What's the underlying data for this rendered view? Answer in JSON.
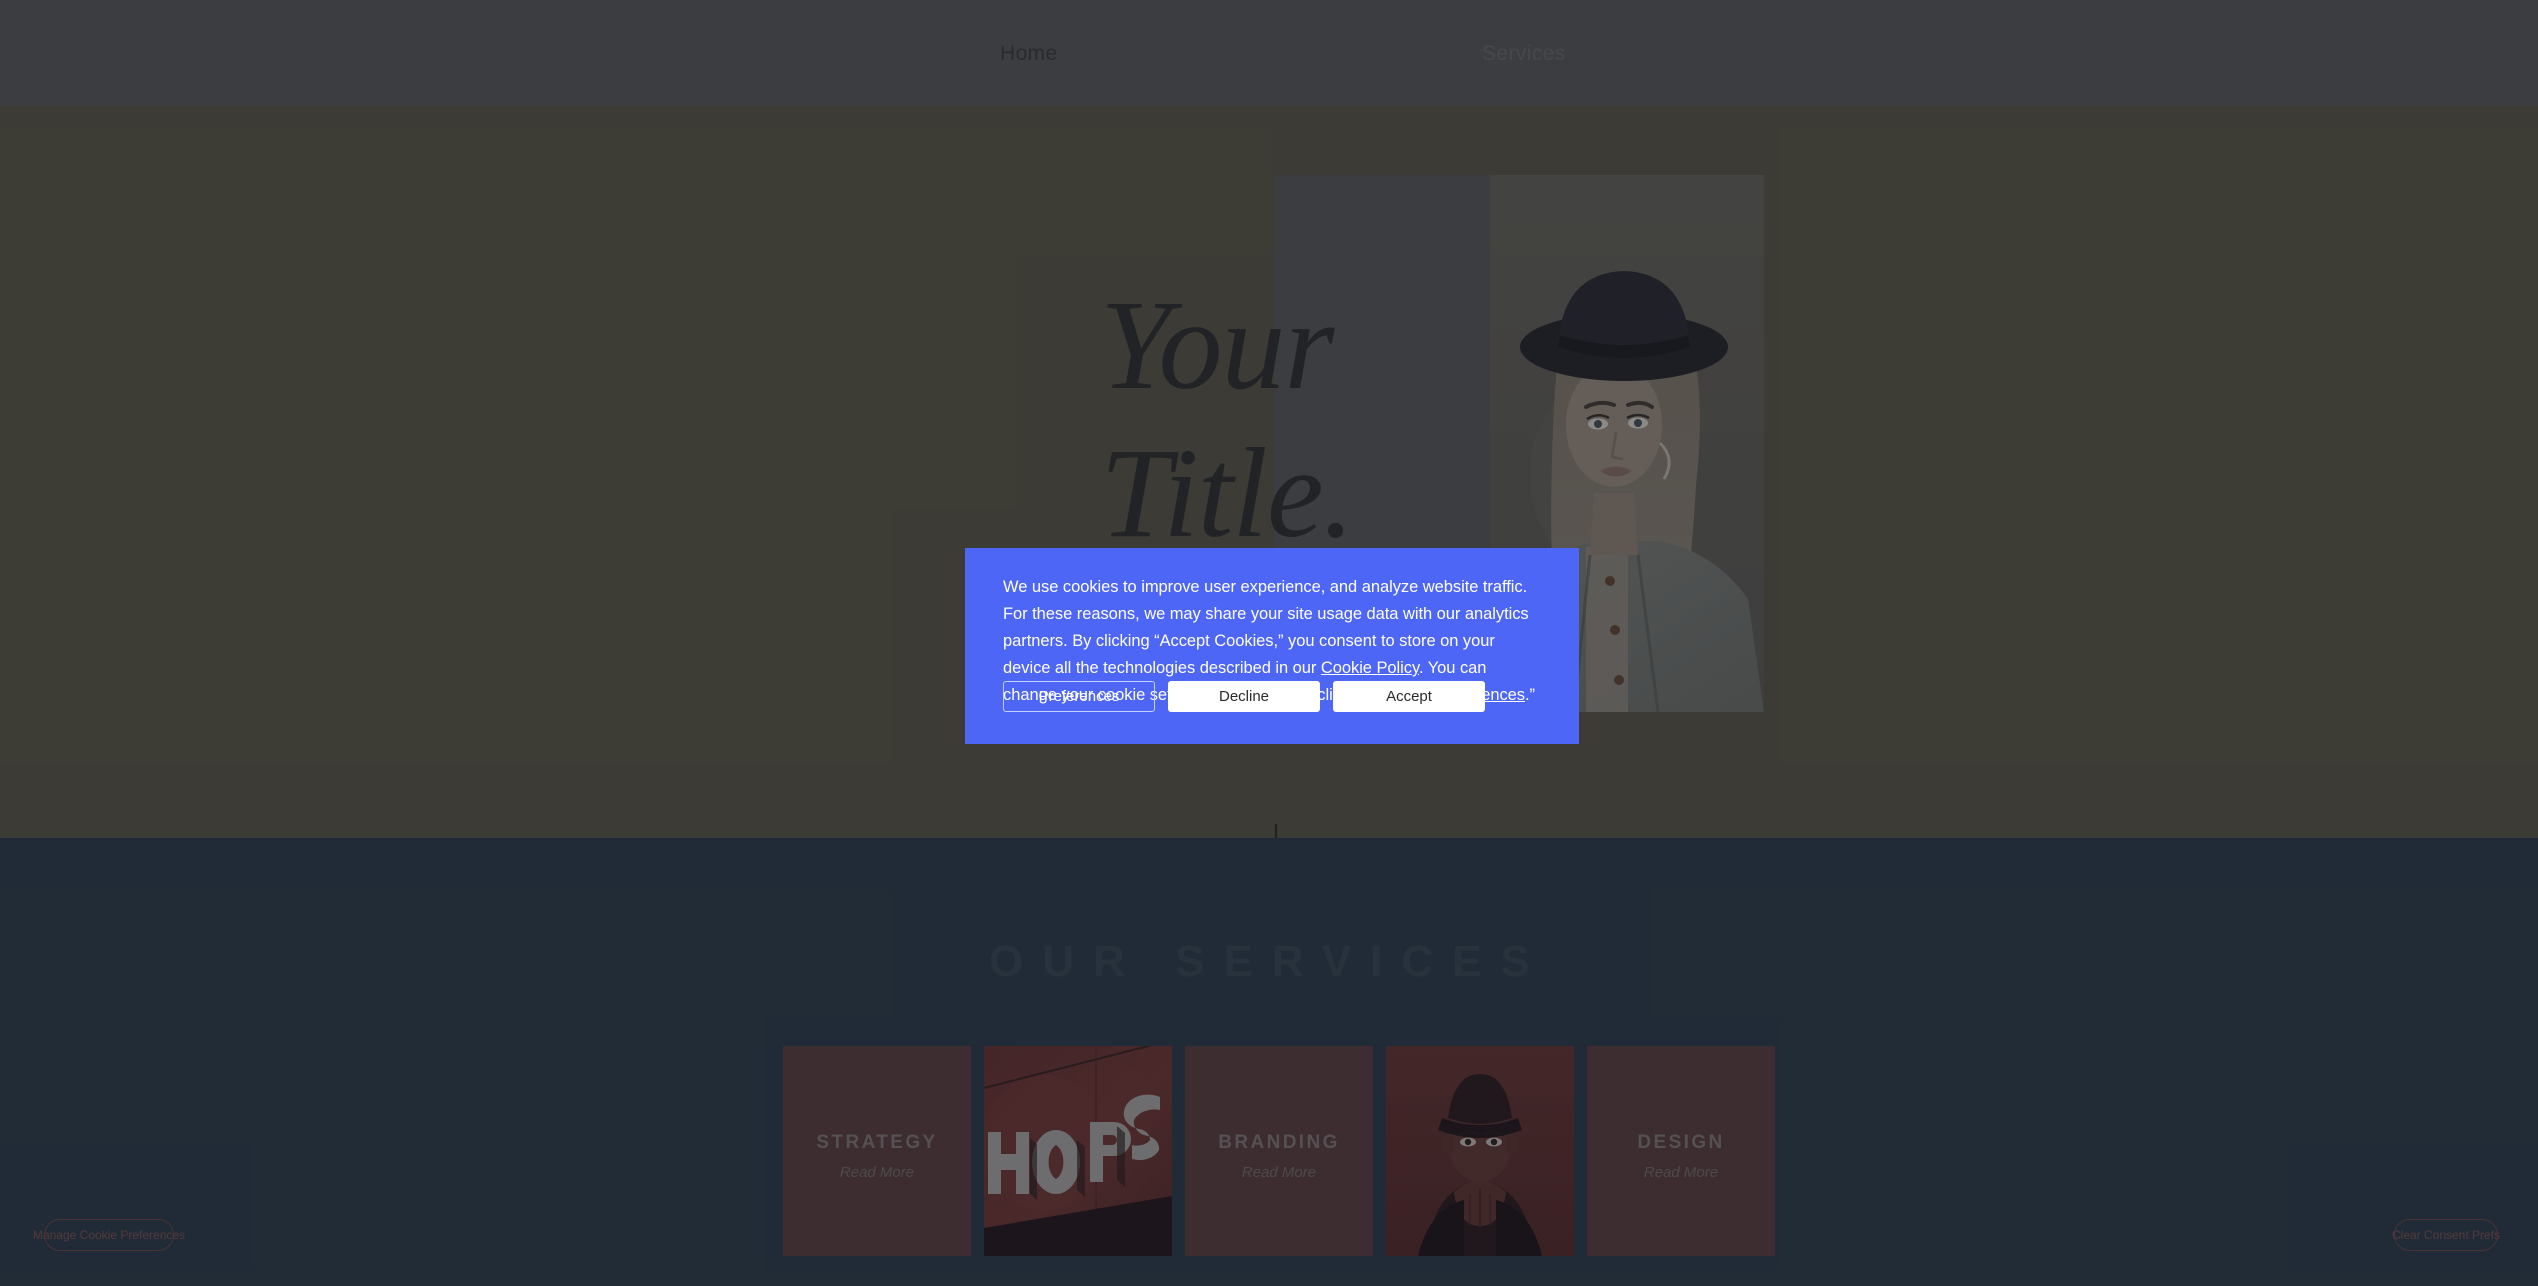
{
  "nav": {
    "items": [
      {
        "label": "Home"
      },
      {
        "label": "Services"
      }
    ]
  },
  "hero": {
    "title_line1": "Your",
    "title_line2": "Title.",
    "scroll_arrow_icon": "arrow-down-icon",
    "photo_alt": "woman-in-black-fedora-hat-and-denim-jacket"
  },
  "services": {
    "heading": "OUR SERVICES",
    "cards": [
      {
        "type": "text",
        "label": "STRATEGY",
        "read_more": "Read More"
      },
      {
        "type": "image",
        "label": "",
        "read_more": "",
        "photo_alt": "red-hops-neon-sign"
      },
      {
        "type": "text",
        "label": "BRANDING",
        "read_more": "Read More"
      },
      {
        "type": "image",
        "label": "",
        "read_more": "",
        "photo_alt": "man-in-cap-portrait"
      },
      {
        "type": "text",
        "label": "DESIGN",
        "read_more": "Read More"
      }
    ]
  },
  "cookie_banner": {
    "text_part1": "We use cookies to improve user experience, and analyze website traffic. For these reasons, we may share your site usage data with our analytics partners. By clicking “Accept Cookies,” you consent to store on your device all the technologies described in our ",
    "link_cookie_policy": "Cookie Policy",
    "text_part2": ". You can change your cookie settings at any time by clicking “",
    "link_cookie_preferences": "Cookie Preferences",
    "text_part3": ".”",
    "buttons": {
      "preferences": "Preferences",
      "decline": "Decline",
      "accept": "Accept"
    }
  },
  "floating_buttons": {
    "manage": "Manage Cookie Preferences",
    "clear": "Clear Consent Prefs"
  },
  "colors": {
    "navbar": "#5f5f5f",
    "hero_bg": "#605c48",
    "services_bg": "#2e3e4d",
    "banner_blue": "#4d66f5",
    "card_red": "#61403f",
    "pill_border": "#7a4a46"
  }
}
